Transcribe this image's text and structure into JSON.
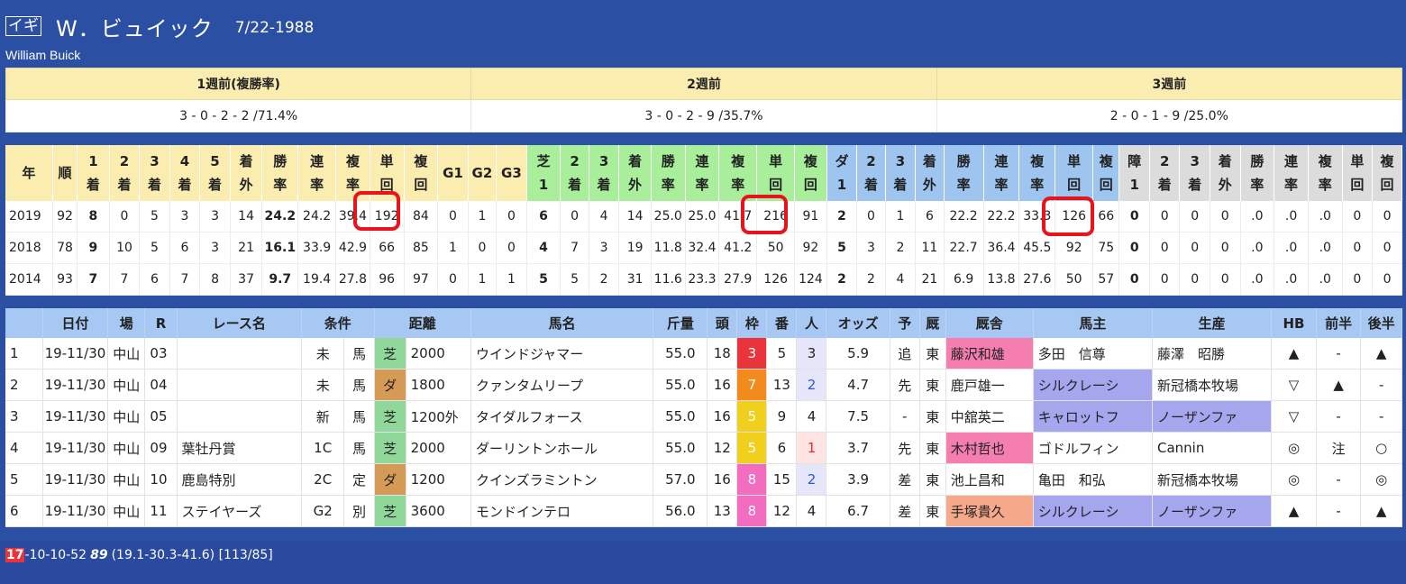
{
  "jockey": {
    "nation": "イギ",
    "name": "W．ビュイック",
    "birth": "7/22-1988",
    "name_en": "William Buick"
  },
  "weeks": {
    "headers": [
      "1週前(複勝率)",
      "2週前",
      "3週前"
    ],
    "values": [
      "3 - 0 - 2 - 2 /71.4%",
      "3 - 0 - 2 - 9 /35.7%",
      "2 - 0 - 1 - 9 /25.0%"
    ]
  },
  "stats": {
    "headers": [
      "年",
      "順",
      "1\n着",
      "2\n着",
      "3\n着",
      "4\n着",
      "5\n着",
      "着\n外",
      "勝\n率",
      "連\n率",
      "複\n率",
      "単\n回",
      "複\n回",
      "G1",
      "G2",
      "G3",
      "芝\n1",
      "2\n着",
      "3\n着",
      "着\n外",
      "勝\n率",
      "連\n率",
      "複\n率",
      "単\n回",
      "複\n回",
      "ダ\n1",
      "2\n着",
      "3\n着",
      "着\n外",
      "勝\n率",
      "連\n率",
      "複\n率",
      "単\n回",
      "複\n回",
      "障\n1",
      "2\n着",
      "3\n着",
      "着\n外",
      "勝\n率",
      "連\n率",
      "複\n率",
      "単\n回",
      "複\n回"
    ],
    "rows": [
      [
        "2019",
        "92",
        "8",
        "0",
        "5",
        "3",
        "3",
        "14",
        "24.2",
        "24.2",
        "39.4",
        "192",
        "84",
        "0",
        "1",
        "0",
        "6",
        "0",
        "4",
        "14",
        "25.0",
        "25.0",
        "41.7",
        "216",
        "91",
        "2",
        "0",
        "1",
        "6",
        "22.2",
        "22.2",
        "33.3",
        "126",
        "66",
        "0",
        "0",
        "0",
        "0",
        ".0",
        ".0",
        ".0",
        "0",
        "0"
      ],
      [
        "2018",
        "78",
        "9",
        "10",
        "5",
        "6",
        "3",
        "21",
        "16.1",
        "33.9",
        "42.9",
        "66",
        "85",
        "1",
        "0",
        "0",
        "4",
        "7",
        "3",
        "19",
        "11.8",
        "32.4",
        "41.2",
        "50",
        "92",
        "5",
        "3",
        "2",
        "11",
        "22.7",
        "36.4",
        "45.5",
        "92",
        "75",
        "0",
        "0",
        "0",
        "0",
        ".0",
        ".0",
        ".0",
        "0",
        "0"
      ],
      [
        "2014",
        "93",
        "7",
        "7",
        "6",
        "7",
        "8",
        "37",
        "9.7",
        "19.4",
        "27.8",
        "96",
        "97",
        "0",
        "1",
        "1",
        "5",
        "5",
        "2",
        "31",
        "11.6",
        "23.3",
        "27.9",
        "126",
        "124",
        "2",
        "2",
        "4",
        "21",
        "6.9",
        "13.8",
        "27.6",
        "50",
        "57",
        "0",
        "0",
        "0",
        "0",
        ".0",
        ".0",
        ".0",
        "0",
        "0"
      ]
    ]
  },
  "races": {
    "headers": [
      "日付",
      "場",
      "R",
      "レース名",
      "条件",
      "距離",
      "馬名",
      "斤量",
      "頭",
      "枠",
      "番",
      "人",
      "オッズ",
      "予",
      "厩",
      "厩舎",
      "馬主",
      "生産",
      "HB",
      "前半",
      "後半"
    ],
    "rows": [
      {
        "no": "1",
        "date": "19-11/30",
        "place": "中山",
        "r": "03",
        "race": "",
        "cls": "未",
        "cond": "馬",
        "surf": "芝",
        "dist": "2000",
        "horse": "ウインドジャマー",
        "wt": "55.0",
        "heads": "18",
        "waku": "3",
        "ban": "5",
        "pop": "3",
        "odds": "5.9",
        "yo": "追",
        "kyu": "東",
        "trainer": "藤沢和雄",
        "owner": "多田　信尊",
        "breeder": "藤澤　昭勝",
        "hb": "▲",
        "zen": "-",
        "kou": "▲"
      },
      {
        "no": "2",
        "date": "19-11/30",
        "place": "中山",
        "r": "04",
        "race": "",
        "cls": "未",
        "cond": "馬",
        "surf": "ダ",
        "dist": "1800",
        "horse": "クァンタムリープ",
        "wt": "55.0",
        "heads": "16",
        "waku": "7",
        "ban": "13",
        "pop": "2",
        "odds": "4.7",
        "yo": "先",
        "kyu": "東",
        "trainer": "鹿戸雄一",
        "owner": "シルクレーシ",
        "breeder": "新冠橋本牧場",
        "hb": "▽",
        "zen": "▲",
        "kou": "-"
      },
      {
        "no": "3",
        "date": "19-11/30",
        "place": "中山",
        "r": "05",
        "race": "",
        "cls": "新",
        "cond": "馬",
        "surf": "芝",
        "dist": "1200外",
        "horse": "タイダルフォース",
        "wt": "55.0",
        "heads": "16",
        "waku": "5",
        "ban": "9",
        "pop": "4",
        "odds": "7.5",
        "yo": "-",
        "kyu": "東",
        "trainer": "中舘英二",
        "owner": "キャロットフ",
        "breeder": "ノーザンファ",
        "hb": "▽",
        "zen": "-",
        "kou": "-"
      },
      {
        "no": "4",
        "date": "19-11/30",
        "place": "中山",
        "r": "09",
        "race": "葉牡丹賞",
        "cls": "1C",
        "cond": "馬",
        "surf": "芝",
        "dist": "2000",
        "horse": "ダーリントンホール",
        "wt": "55.0",
        "heads": "12",
        "waku": "5",
        "ban": "6",
        "pop": "1",
        "odds": "3.7",
        "yo": "先",
        "kyu": "東",
        "trainer": "木村哲也",
        "owner": "ゴドルフィン",
        "breeder": "Cannin",
        "hb": "◎",
        "zen": "注",
        "kou": "○"
      },
      {
        "no": "5",
        "date": "19-11/30",
        "place": "中山",
        "r": "10",
        "race": "鹿島特別",
        "cls": "2C",
        "cond": "定",
        "surf": "ダ",
        "dist": "1200",
        "horse": "クインズラミントン",
        "wt": "57.0",
        "heads": "16",
        "waku": "8",
        "ban": "15",
        "pop": "2",
        "odds": "3.9",
        "yo": "差",
        "kyu": "東",
        "trainer": "池上昌和",
        "owner": "亀田　和弘",
        "breeder": "新冠橋本牧場",
        "hb": "◎",
        "zen": "-",
        "kou": "◎"
      },
      {
        "no": "6",
        "date": "19-11/30",
        "place": "中山",
        "r": "11",
        "race": "ステイヤーズ",
        "cls": "G2",
        "cond": "別",
        "surf": "芝",
        "dist": "3600",
        "horse": "モンドインテロ",
        "wt": "56.0",
        "heads": "13",
        "waku": "8",
        "ban": "12",
        "pop": "4",
        "odds": "6.7",
        "yo": "差",
        "kyu": "東",
        "trainer": "手塚貴久",
        "owner": "シルクレーシ",
        "breeder": "ノーザンファ",
        "hb": "▲",
        "zen": "-",
        "kou": "▲"
      }
    ]
  },
  "footer": {
    "box": "17",
    "rest": "-10-10-52",
    "rating": "89",
    "splits": "(19.1-30.3-41.6) [113/85]"
  },
  "highlight_color": "#e8141b"
}
